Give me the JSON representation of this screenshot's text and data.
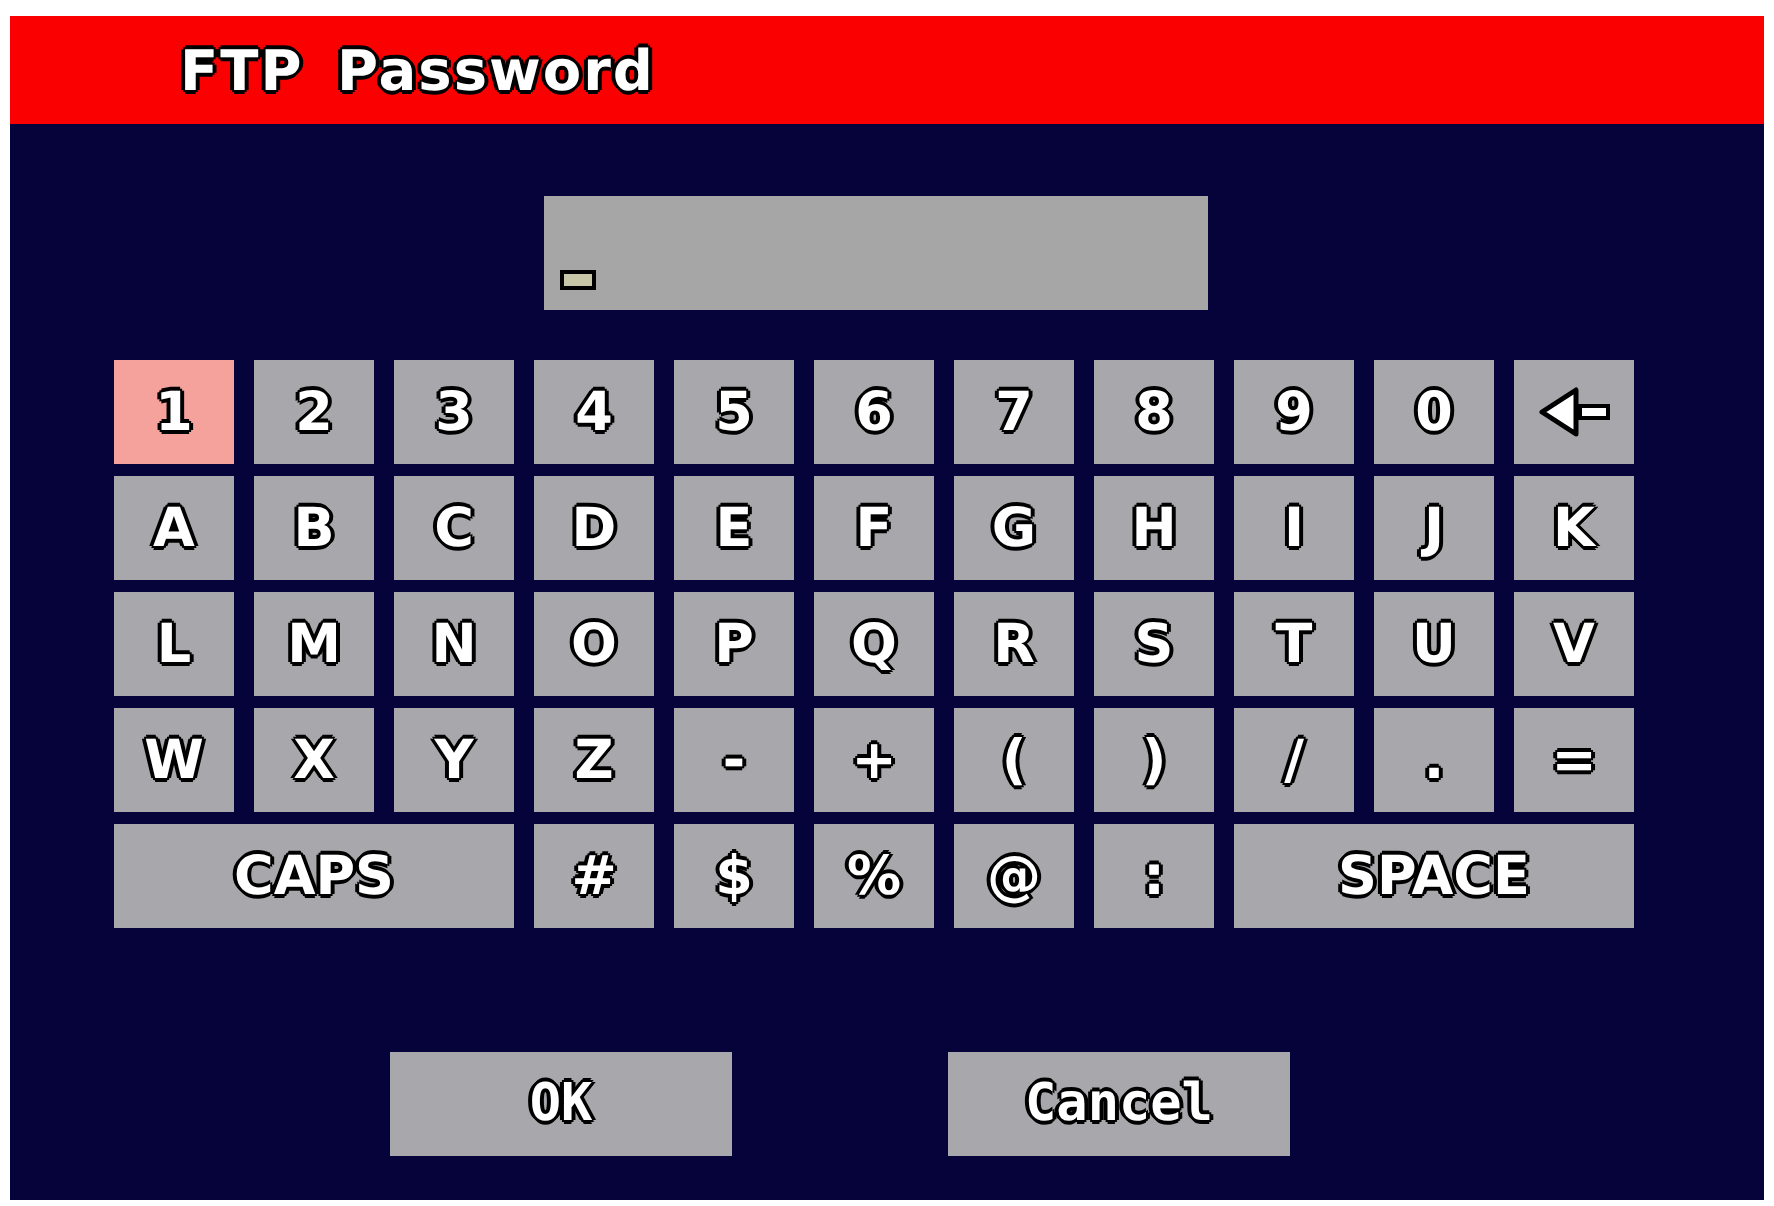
{
  "window": {
    "title": "FTP Password"
  },
  "password_field": {
    "focused": true
  },
  "keyboard": {
    "keys": [
      {
        "kind": "char",
        "label": "1",
        "selected": true
      },
      {
        "kind": "char",
        "label": "2",
        "selected": false
      },
      {
        "kind": "char",
        "label": "3",
        "selected": false
      },
      {
        "kind": "char",
        "label": "4",
        "selected": false
      },
      {
        "kind": "char",
        "label": "5",
        "selected": false
      },
      {
        "kind": "char",
        "label": "6",
        "selected": false
      },
      {
        "kind": "char",
        "label": "7",
        "selected": false
      },
      {
        "kind": "char",
        "label": "8",
        "selected": false
      },
      {
        "kind": "char",
        "label": "9",
        "selected": false
      },
      {
        "kind": "char",
        "label": "0",
        "selected": false
      },
      {
        "kind": "backspace",
        "selected": false
      },
      {
        "kind": "char",
        "label": "A",
        "selected": false
      },
      {
        "kind": "char",
        "label": "B",
        "selected": false
      },
      {
        "kind": "char",
        "label": "C",
        "selected": false
      },
      {
        "kind": "char",
        "label": "D",
        "selected": false
      },
      {
        "kind": "char",
        "label": "E",
        "selected": false
      },
      {
        "kind": "char",
        "label": "F",
        "selected": false
      },
      {
        "kind": "char",
        "label": "G",
        "selected": false
      },
      {
        "kind": "char",
        "label": "H",
        "selected": false
      },
      {
        "kind": "char",
        "label": "I",
        "selected": false
      },
      {
        "kind": "char",
        "label": "J",
        "selected": false
      },
      {
        "kind": "char",
        "label": "K",
        "selected": false
      },
      {
        "kind": "char",
        "label": "L",
        "selected": false
      },
      {
        "kind": "char",
        "label": "M",
        "selected": false
      },
      {
        "kind": "char",
        "label": "N",
        "selected": false
      },
      {
        "kind": "char",
        "label": "O",
        "selected": false
      },
      {
        "kind": "char",
        "label": "P",
        "selected": false
      },
      {
        "kind": "char",
        "label": "Q",
        "selected": false
      },
      {
        "kind": "char",
        "label": "R",
        "selected": false
      },
      {
        "kind": "char",
        "label": "S",
        "selected": false
      },
      {
        "kind": "char",
        "label": "T",
        "selected": false
      },
      {
        "kind": "char",
        "label": "U",
        "selected": false
      },
      {
        "kind": "char",
        "label": "V",
        "selected": false
      },
      {
        "kind": "char",
        "label": "W",
        "selected": false
      },
      {
        "kind": "char",
        "label": "X",
        "selected": false
      },
      {
        "kind": "char",
        "label": "Y",
        "selected": false
      },
      {
        "kind": "char",
        "label": "Z",
        "selected": false
      },
      {
        "kind": "char",
        "label": "-",
        "selected": false
      },
      {
        "kind": "char",
        "label": "+",
        "selected": false
      },
      {
        "kind": "char",
        "label": "(",
        "selected": false
      },
      {
        "kind": "char",
        "label": ")",
        "selected": false
      },
      {
        "kind": "char",
        "label": "/",
        "selected": false
      },
      {
        "kind": "char",
        "label": ".",
        "selected": false
      },
      {
        "kind": "char",
        "label": "=",
        "selected": false
      },
      {
        "kind": "wide",
        "label": "CAPS",
        "selected": false
      },
      {
        "kind": "char",
        "label": "#",
        "selected": false
      },
      {
        "kind": "char",
        "label": "$",
        "selected": false
      },
      {
        "kind": "char",
        "label": "%",
        "selected": false
      },
      {
        "kind": "char",
        "label": "@",
        "selected": false
      },
      {
        "kind": "char",
        "label": ":",
        "selected": false
      },
      {
        "kind": "wide",
        "label": "SPACE",
        "selected": false
      }
    ]
  },
  "buttons": [
    {
      "label": "OK",
      "selected": false
    },
    {
      "label": "Cancel",
      "selected": false
    }
  ]
}
